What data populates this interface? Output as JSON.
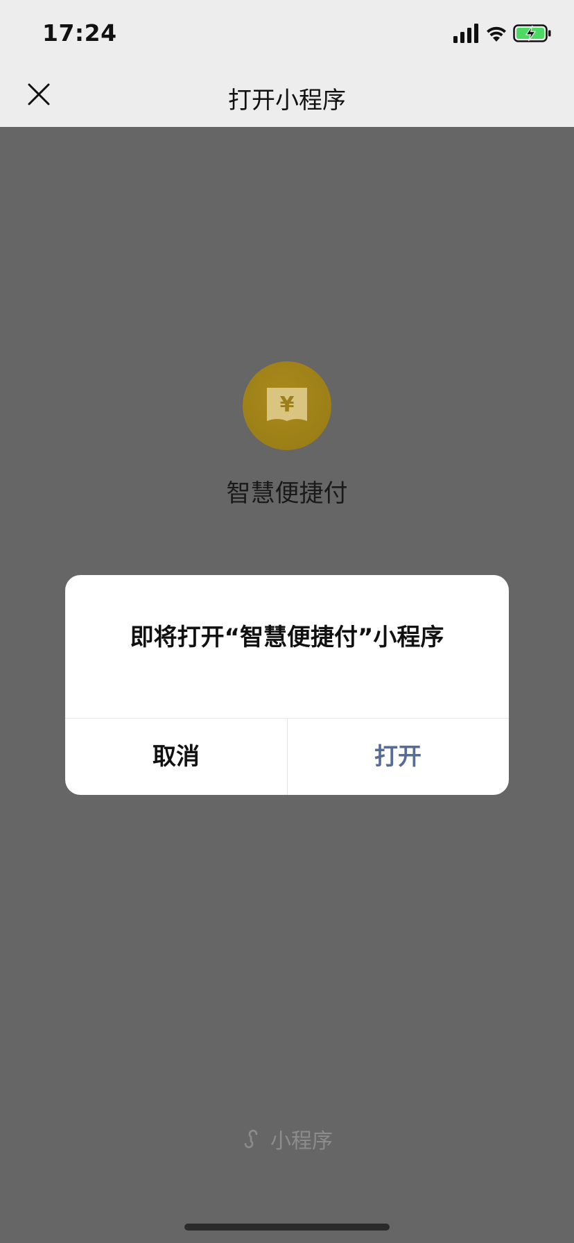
{
  "status_bar": {
    "time": "17:24",
    "icons": [
      "signal-icon",
      "wifi-icon",
      "battery-charging-icon"
    ],
    "battery_color": "#4cd964"
  },
  "nav": {
    "title": "打开小程序",
    "close_icon": "close-icon"
  },
  "mini_program": {
    "name": "智慧便捷付",
    "logo_icon": "yen-wallet-icon",
    "logo_color": "#a8891c"
  },
  "dialog": {
    "message": "即将打开“智慧便捷付”小程序",
    "cancel_label": "取消",
    "open_label": "打开",
    "open_color": "#576b95"
  },
  "footer": {
    "label": "小程序",
    "icon": "miniprogram-link-icon"
  },
  "colors": {
    "overlay": "#666666",
    "header_bg": "#ededed"
  }
}
